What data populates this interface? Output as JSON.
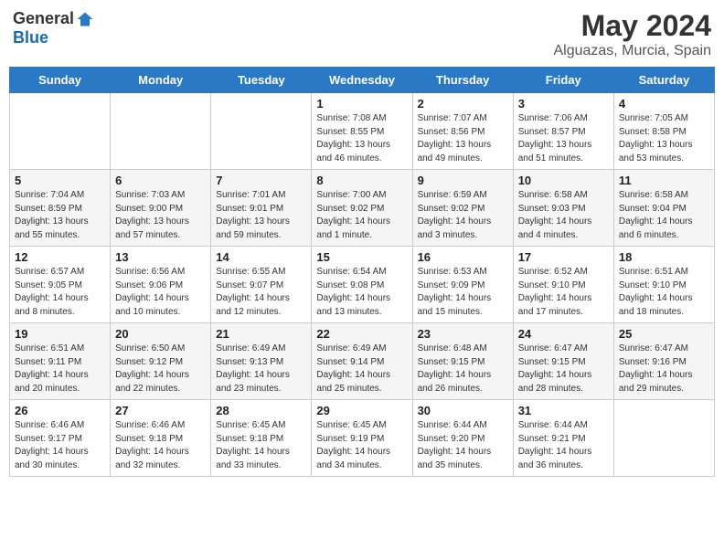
{
  "header": {
    "logo_general": "General",
    "logo_blue": "Blue",
    "month_year": "May 2024",
    "location": "Alguazas, Murcia, Spain"
  },
  "days_of_week": [
    "Sunday",
    "Monday",
    "Tuesday",
    "Wednesday",
    "Thursday",
    "Friday",
    "Saturday"
  ],
  "weeks": [
    [
      {
        "day": "",
        "sunrise": "",
        "sunset": "",
        "daylight": ""
      },
      {
        "day": "",
        "sunrise": "",
        "sunset": "",
        "daylight": ""
      },
      {
        "day": "",
        "sunrise": "",
        "sunset": "",
        "daylight": ""
      },
      {
        "day": "1",
        "sunrise": "Sunrise: 7:08 AM",
        "sunset": "Sunset: 8:55 PM",
        "daylight": "Daylight: 13 hours and 46 minutes."
      },
      {
        "day": "2",
        "sunrise": "Sunrise: 7:07 AM",
        "sunset": "Sunset: 8:56 PM",
        "daylight": "Daylight: 13 hours and 49 minutes."
      },
      {
        "day": "3",
        "sunrise": "Sunrise: 7:06 AM",
        "sunset": "Sunset: 8:57 PM",
        "daylight": "Daylight: 13 hours and 51 minutes."
      },
      {
        "day": "4",
        "sunrise": "Sunrise: 7:05 AM",
        "sunset": "Sunset: 8:58 PM",
        "daylight": "Daylight: 13 hours and 53 minutes."
      }
    ],
    [
      {
        "day": "5",
        "sunrise": "Sunrise: 7:04 AM",
        "sunset": "Sunset: 8:59 PM",
        "daylight": "Daylight: 13 hours and 55 minutes."
      },
      {
        "day": "6",
        "sunrise": "Sunrise: 7:03 AM",
        "sunset": "Sunset: 9:00 PM",
        "daylight": "Daylight: 13 hours and 57 minutes."
      },
      {
        "day": "7",
        "sunrise": "Sunrise: 7:01 AM",
        "sunset": "Sunset: 9:01 PM",
        "daylight": "Daylight: 13 hours and 59 minutes."
      },
      {
        "day": "8",
        "sunrise": "Sunrise: 7:00 AM",
        "sunset": "Sunset: 9:02 PM",
        "daylight": "Daylight: 14 hours and 1 minute."
      },
      {
        "day": "9",
        "sunrise": "Sunrise: 6:59 AM",
        "sunset": "Sunset: 9:02 PM",
        "daylight": "Daylight: 14 hours and 3 minutes."
      },
      {
        "day": "10",
        "sunrise": "Sunrise: 6:58 AM",
        "sunset": "Sunset: 9:03 PM",
        "daylight": "Daylight: 14 hours and 4 minutes."
      },
      {
        "day": "11",
        "sunrise": "Sunrise: 6:58 AM",
        "sunset": "Sunset: 9:04 PM",
        "daylight": "Daylight: 14 hours and 6 minutes."
      }
    ],
    [
      {
        "day": "12",
        "sunrise": "Sunrise: 6:57 AM",
        "sunset": "Sunset: 9:05 PM",
        "daylight": "Daylight: 14 hours and 8 minutes."
      },
      {
        "day": "13",
        "sunrise": "Sunrise: 6:56 AM",
        "sunset": "Sunset: 9:06 PM",
        "daylight": "Daylight: 14 hours and 10 minutes."
      },
      {
        "day": "14",
        "sunrise": "Sunrise: 6:55 AM",
        "sunset": "Sunset: 9:07 PM",
        "daylight": "Daylight: 14 hours and 12 minutes."
      },
      {
        "day": "15",
        "sunrise": "Sunrise: 6:54 AM",
        "sunset": "Sunset: 9:08 PM",
        "daylight": "Daylight: 14 hours and 13 minutes."
      },
      {
        "day": "16",
        "sunrise": "Sunrise: 6:53 AM",
        "sunset": "Sunset: 9:09 PM",
        "daylight": "Daylight: 14 hours and 15 minutes."
      },
      {
        "day": "17",
        "sunrise": "Sunrise: 6:52 AM",
        "sunset": "Sunset: 9:10 PM",
        "daylight": "Daylight: 14 hours and 17 minutes."
      },
      {
        "day": "18",
        "sunrise": "Sunrise: 6:51 AM",
        "sunset": "Sunset: 9:10 PM",
        "daylight": "Daylight: 14 hours and 18 minutes."
      }
    ],
    [
      {
        "day": "19",
        "sunrise": "Sunrise: 6:51 AM",
        "sunset": "Sunset: 9:11 PM",
        "daylight": "Daylight: 14 hours and 20 minutes."
      },
      {
        "day": "20",
        "sunrise": "Sunrise: 6:50 AM",
        "sunset": "Sunset: 9:12 PM",
        "daylight": "Daylight: 14 hours and 22 minutes."
      },
      {
        "day": "21",
        "sunrise": "Sunrise: 6:49 AM",
        "sunset": "Sunset: 9:13 PM",
        "daylight": "Daylight: 14 hours and 23 minutes."
      },
      {
        "day": "22",
        "sunrise": "Sunrise: 6:49 AM",
        "sunset": "Sunset: 9:14 PM",
        "daylight": "Daylight: 14 hours and 25 minutes."
      },
      {
        "day": "23",
        "sunrise": "Sunrise: 6:48 AM",
        "sunset": "Sunset: 9:15 PM",
        "daylight": "Daylight: 14 hours and 26 minutes."
      },
      {
        "day": "24",
        "sunrise": "Sunrise: 6:47 AM",
        "sunset": "Sunset: 9:15 PM",
        "daylight": "Daylight: 14 hours and 28 minutes."
      },
      {
        "day": "25",
        "sunrise": "Sunrise: 6:47 AM",
        "sunset": "Sunset: 9:16 PM",
        "daylight": "Daylight: 14 hours and 29 minutes."
      }
    ],
    [
      {
        "day": "26",
        "sunrise": "Sunrise: 6:46 AM",
        "sunset": "Sunset: 9:17 PM",
        "daylight": "Daylight: 14 hours and 30 minutes."
      },
      {
        "day": "27",
        "sunrise": "Sunrise: 6:46 AM",
        "sunset": "Sunset: 9:18 PM",
        "daylight": "Daylight: 14 hours and 32 minutes."
      },
      {
        "day": "28",
        "sunrise": "Sunrise: 6:45 AM",
        "sunset": "Sunset: 9:18 PM",
        "daylight": "Daylight: 14 hours and 33 minutes."
      },
      {
        "day": "29",
        "sunrise": "Sunrise: 6:45 AM",
        "sunset": "Sunset: 9:19 PM",
        "daylight": "Daylight: 14 hours and 34 minutes."
      },
      {
        "day": "30",
        "sunrise": "Sunrise: 6:44 AM",
        "sunset": "Sunset: 9:20 PM",
        "daylight": "Daylight: 14 hours and 35 minutes."
      },
      {
        "day": "31",
        "sunrise": "Sunrise: 6:44 AM",
        "sunset": "Sunset: 9:21 PM",
        "daylight": "Daylight: 14 hours and 36 minutes."
      },
      {
        "day": "",
        "sunrise": "",
        "sunset": "",
        "daylight": ""
      }
    ]
  ]
}
